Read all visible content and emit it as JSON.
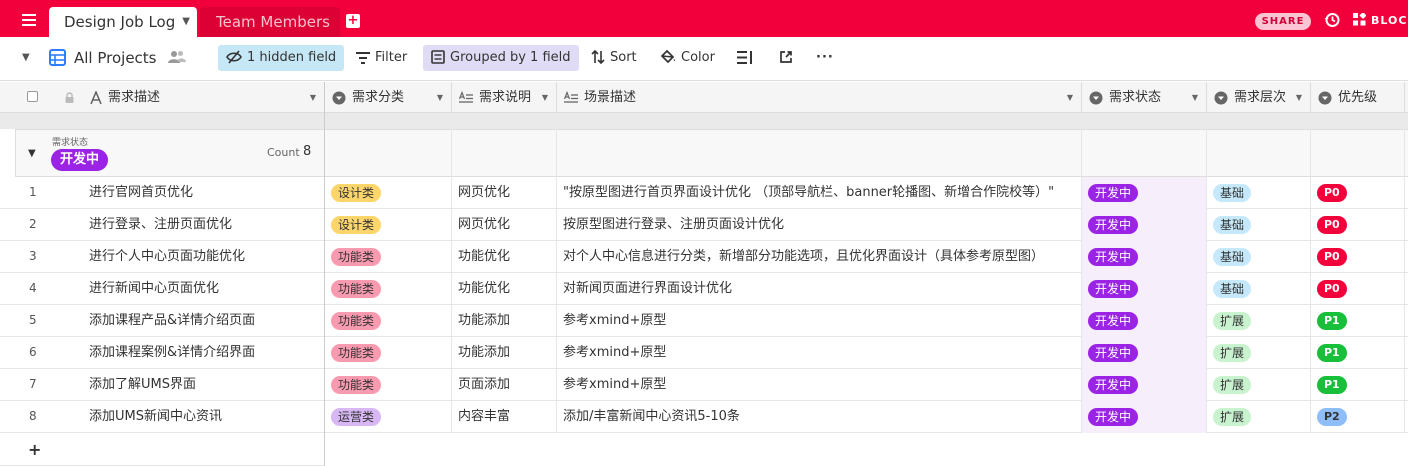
{
  "colors": {
    "brand": "#f2003c",
    "status_dev": "#9a23e6",
    "cat_design": "#fcd56b",
    "cat_function": "#f99bb0",
    "cat_ops": "#d7b7f4",
    "level_basic": "#c5e9fa",
    "level_extend": "#c9f2cf",
    "p0": "#f2003c",
    "p1": "#18bf3a",
    "p2": "#8fbdf7"
  },
  "topbar": {
    "menu_icon": "hamburger-icon",
    "tabs": [
      {
        "label": "Design Job Log",
        "active": true
      },
      {
        "label": "Team Members",
        "active": false
      }
    ],
    "share_label": "SHARE",
    "blocks_label": "BLOC"
  },
  "toolbar": {
    "view_name": "All Projects",
    "hidden_fields": "1 hidden field",
    "filter": "Filter",
    "grouped": "Grouped by 1 field",
    "sort": "Sort",
    "color": "Color"
  },
  "columns": [
    {
      "label": "需求描述",
      "icon": "text-icon"
    },
    {
      "label": "需求分类",
      "icon": "single-select-icon"
    },
    {
      "label": "需求说明",
      "icon": "long-text-icon"
    },
    {
      "label": "场景描述",
      "icon": "long-text-icon"
    },
    {
      "label": "需求状态",
      "icon": "single-select-icon"
    },
    {
      "label": "需求层次",
      "icon": "single-select-icon"
    },
    {
      "label": "优先级",
      "icon": "single-select-icon"
    }
  ],
  "group": {
    "field": "需求状态",
    "value": "开发中",
    "count_label": "Count",
    "count": "8"
  },
  "rows": [
    {
      "num": "1",
      "desc": "进行官网首页优化",
      "cat": "设计类",
      "cat_color": "#fcd56b",
      "expl": "网页优化",
      "scene": "\"按原型图进行首页界面设计优化 （顶部导航栏、banner轮播图、新增合作院校等）\"",
      "status": "开发中",
      "level": "基础",
      "level_color": "#c5e9fa",
      "prio": "P0",
      "prio_color": "#f2003c",
      "prio_text": "#ffffff"
    },
    {
      "num": "2",
      "desc": "进行登录、注册页面优化",
      "cat": "设计类",
      "cat_color": "#fcd56b",
      "expl": "网页优化",
      "scene": "按原型图进行登录、注册页面设计优化",
      "status": "开发中",
      "level": "基础",
      "level_color": "#c5e9fa",
      "prio": "P0",
      "prio_color": "#f2003c",
      "prio_text": "#ffffff"
    },
    {
      "num": "3",
      "desc": "进行个人中心页面功能优化",
      "cat": "功能类",
      "cat_color": "#f99bb0",
      "expl": "功能优化",
      "scene": "对个人中心信息进行分类，新增部分功能选项，且优化界面设计（具体参考原型图）",
      "status": "开发中",
      "level": "基础",
      "level_color": "#c5e9fa",
      "prio": "P0",
      "prio_color": "#f2003c",
      "prio_text": "#ffffff"
    },
    {
      "num": "4",
      "desc": "进行新闻中心页面优化",
      "cat": "功能类",
      "cat_color": "#f99bb0",
      "expl": "功能优化",
      "scene": "对新闻页面进行界面设计优化",
      "status": "开发中",
      "level": "基础",
      "level_color": "#c5e9fa",
      "prio": "P0",
      "prio_color": "#f2003c",
      "prio_text": "#ffffff"
    },
    {
      "num": "5",
      "desc": "添加课程产品&详情介绍页面",
      "cat": "功能类",
      "cat_color": "#f99bb0",
      "expl": "功能添加",
      "scene": "参考xmind+原型",
      "status": "开发中",
      "level": "扩展",
      "level_color": "#c9f2cf",
      "prio": "P1",
      "prio_color": "#18bf3a",
      "prio_text": "#ffffff"
    },
    {
      "num": "6",
      "desc": "添加课程案例&详情介绍界面",
      "cat": "功能类",
      "cat_color": "#f99bb0",
      "expl": "功能添加",
      "scene": "参考xmind+原型",
      "status": "开发中",
      "level": "扩展",
      "level_color": "#c9f2cf",
      "prio": "P1",
      "prio_color": "#18bf3a",
      "prio_text": "#ffffff"
    },
    {
      "num": "7",
      "desc": "添加了解UMS界面",
      "cat": "功能类",
      "cat_color": "#f99bb0",
      "expl": "页面添加",
      "scene": "参考xmind+原型",
      "status": "开发中",
      "level": "扩展",
      "level_color": "#c9f2cf",
      "prio": "P1",
      "prio_color": "#18bf3a",
      "prio_text": "#ffffff"
    },
    {
      "num": "8",
      "desc": "添加UMS新闻中心资讯",
      "cat": "运营类",
      "cat_color": "#d7b7f4",
      "expl": "内容丰富",
      "scene": "添加/丰富新闻中心资讯5-10条",
      "status": "开发中",
      "level": "扩展",
      "level_color": "#c9f2cf",
      "prio": "P2",
      "prio_color": "#8fbdf7",
      "prio_text": "#333333"
    }
  ],
  "add_row_label": "+"
}
